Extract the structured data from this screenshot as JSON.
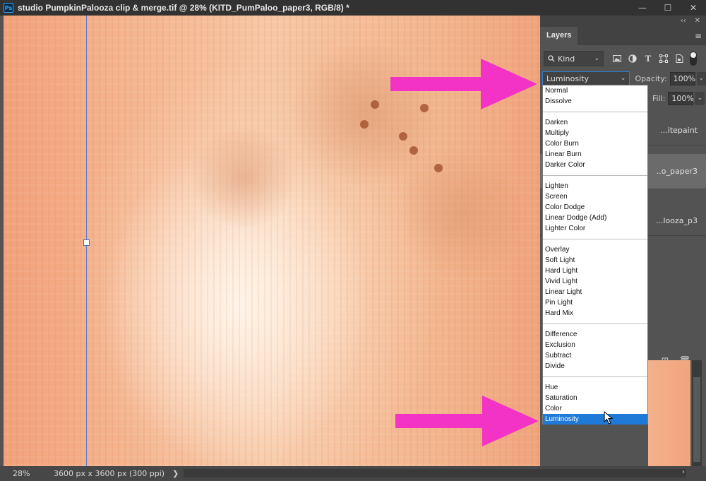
{
  "window": {
    "app_icon": "Ps",
    "title": "studio PumpkinPalooza clip & merge.tif @ 28% (KITD_PumPaloo_paper3, RGB/8) *",
    "minimize": "—",
    "maximize": "☐",
    "close": "✕"
  },
  "status": {
    "zoom": "28%",
    "doc_size": "3600 px x 3600 px (300 ppi)",
    "arrow": "❯"
  },
  "panel": {
    "collapse_glyph": "‹‹",
    "close_glyph": "✕",
    "tab_label": "Layers",
    "menu_glyph": "≡",
    "filter": {
      "search_glyph": "🔍",
      "kind_label": "Kind",
      "icons": [
        "image-filter-icon",
        "adjustment-filter-icon",
        "type-filter-icon",
        "shape-filter-icon",
        "smart-object-filter-icon"
      ]
    },
    "blend_mode_value": "Luminosity",
    "opacity_label": "Opacity:",
    "opacity_value": "100%",
    "fill_label": "Fill:",
    "fill_value": "100%",
    "layers": [
      {
        "name": "...itepaint"
      },
      {
        "name": "..o_paper3"
      },
      {
        "name": "...looza_p3"
      }
    ],
    "bottom_icons": [
      "new-layer-icon",
      "delete-layer-icon"
    ],
    "new_layer_glyph": "⊞",
    "delete_layer_glyph": "🗑"
  },
  "blend_modes": {
    "groups": [
      [
        "Normal",
        "Dissolve"
      ],
      [
        "Darken",
        "Multiply",
        "Color Burn",
        "Linear Burn",
        "Darker Color"
      ],
      [
        "Lighten",
        "Screen",
        "Color Dodge",
        "Linear Dodge (Add)",
        "Lighter Color"
      ],
      [
        "Overlay",
        "Soft Light",
        "Hard Light",
        "Vivid Light",
        "Linear Light",
        "Pin Light",
        "Hard Mix"
      ],
      [
        "Difference",
        "Exclusion",
        "Subtract",
        "Divide"
      ],
      [
        "Hue",
        "Saturation",
        "Color",
        "Luminosity"
      ]
    ],
    "selected": "Luminosity"
  },
  "colors": {
    "arrow_pink": "#f233c6",
    "selection_blue": "#1e7ad6",
    "guide_blue": "#5b7fd0"
  }
}
